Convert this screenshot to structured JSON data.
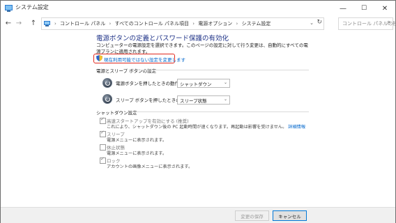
{
  "window": {
    "title": "システム設定"
  },
  "title_controls": {
    "minimize": "—",
    "maximize": "☐",
    "close": "✕"
  },
  "nav": {
    "back": "←",
    "forward": "→",
    "up": "↑"
  },
  "address": {
    "crumbs": [
      "コントロール パネル",
      "すべてのコントロール パネル項目",
      "電源オプション",
      "システム設定"
    ],
    "separator": "›",
    "dropdown": "⌄",
    "refresh": "↻"
  },
  "search": {
    "placeholder": "コントロール パネルの検索",
    "icon": "⌕"
  },
  "main": {
    "heading": "電源ボタンの定義とパスワード保護の有効化",
    "description": "コンピューターの電源設定を選択できます。このページの設定に対して行う変更は、自動的にすべての電源プランに適用されます。",
    "change_link": "現在利用可能ではない設定を変更します"
  },
  "power_section": {
    "title": "電源とスリープ ボタンの設定",
    "rows": [
      {
        "label": "電源ボタンを押したときの動作:",
        "value": "シャットダウン"
      },
      {
        "label": "スリープ ボタンを押したときの動作:",
        "value": "スリープ状態"
      }
    ]
  },
  "shutdown_section": {
    "title": "シャットダウン設定",
    "items": [
      {
        "label": "高速スタートアップを有効にする (推奨)",
        "sub": "これにより、シャットダウン後の PC 起動時間が速くなります。再起動は影響を受けません。",
        "link": "詳細情報",
        "checked": true
      },
      {
        "label": "スリープ",
        "sub": "電源メニューに表示されます。",
        "checked": true
      },
      {
        "label": "休止状態",
        "sub": "電源メニューに表示されます。",
        "checked": false
      },
      {
        "label": "ロック",
        "sub": "アカウントの画像メニューに表示されます。",
        "checked": true
      }
    ]
  },
  "footer": {
    "save": "変更の保存",
    "cancel": "キャンセル"
  },
  "colors": {
    "heading": "#1e3287",
    "link": "#0066cc",
    "highlight": "#e0281e"
  }
}
